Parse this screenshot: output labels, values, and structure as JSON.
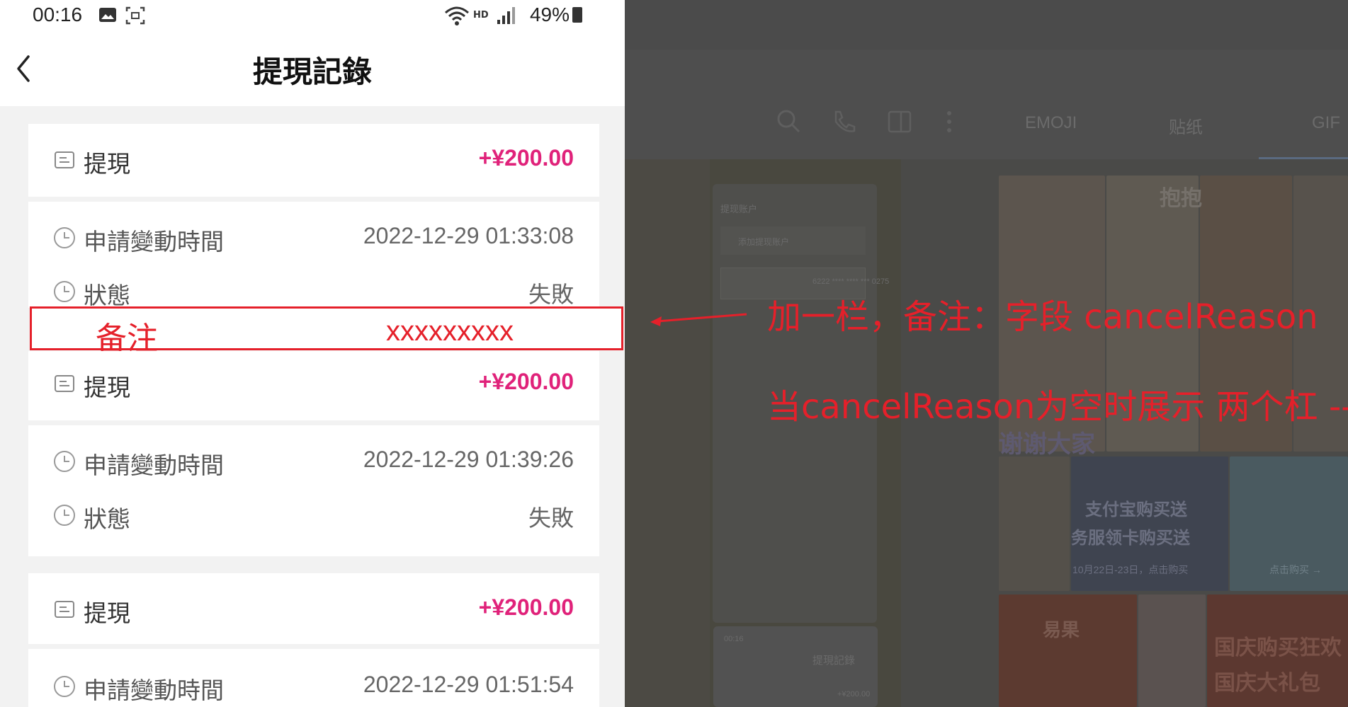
{
  "status_bar": {
    "time": "00:16",
    "battery": "49%"
  },
  "header": {
    "title": "提現記錄"
  },
  "records": [
    {
      "type_label": "提現",
      "amount": "+¥200.00",
      "time_label": "申請變動時間",
      "time_value": "2022-12-29 01:33:08",
      "status_label": "狀態",
      "status_value": "失敗"
    },
    {
      "type_label": "提現",
      "amount": "+¥200.00",
      "time_label": "申請變動時間",
      "time_value": "2022-12-29 01:39:26",
      "status_label": "狀態",
      "status_value": "失敗"
    },
    {
      "type_label": "提現",
      "amount": "+¥200.00",
      "time_label": "申請變動時間",
      "time_value": "2022-12-29 01:51:54"
    }
  ],
  "annotation": {
    "note_label": "备注",
    "note_value": "xxxxxxxxx",
    "line1": "加一栏，备注：字段 cancelReason",
    "line2": "当cancelReason为空时展示 两个杠 --"
  },
  "background": {
    "tabs": [
      "EMOJI",
      "贴纸",
      "GIF"
    ],
    "mini_title": "提現記錄",
    "mini_amount": "+¥200.00",
    "mini_time": "00:16",
    "field_label": "提现账户",
    "field_placeholder": "添加提现账户",
    "card_number": "6222 **** **** *** 0275",
    "ad_texts": [
      "支付宝购买送",
      "务服领卡购买送",
      "10月22日-23日，点击购买",
      "点击购买 →",
      "易果",
      "国庆购买狂欢",
      "国庆大礼包",
      "谢谢大家",
      "抱抱"
    ]
  },
  "colors": {
    "accent": "#e0227a",
    "annotation": "#e5202a"
  }
}
